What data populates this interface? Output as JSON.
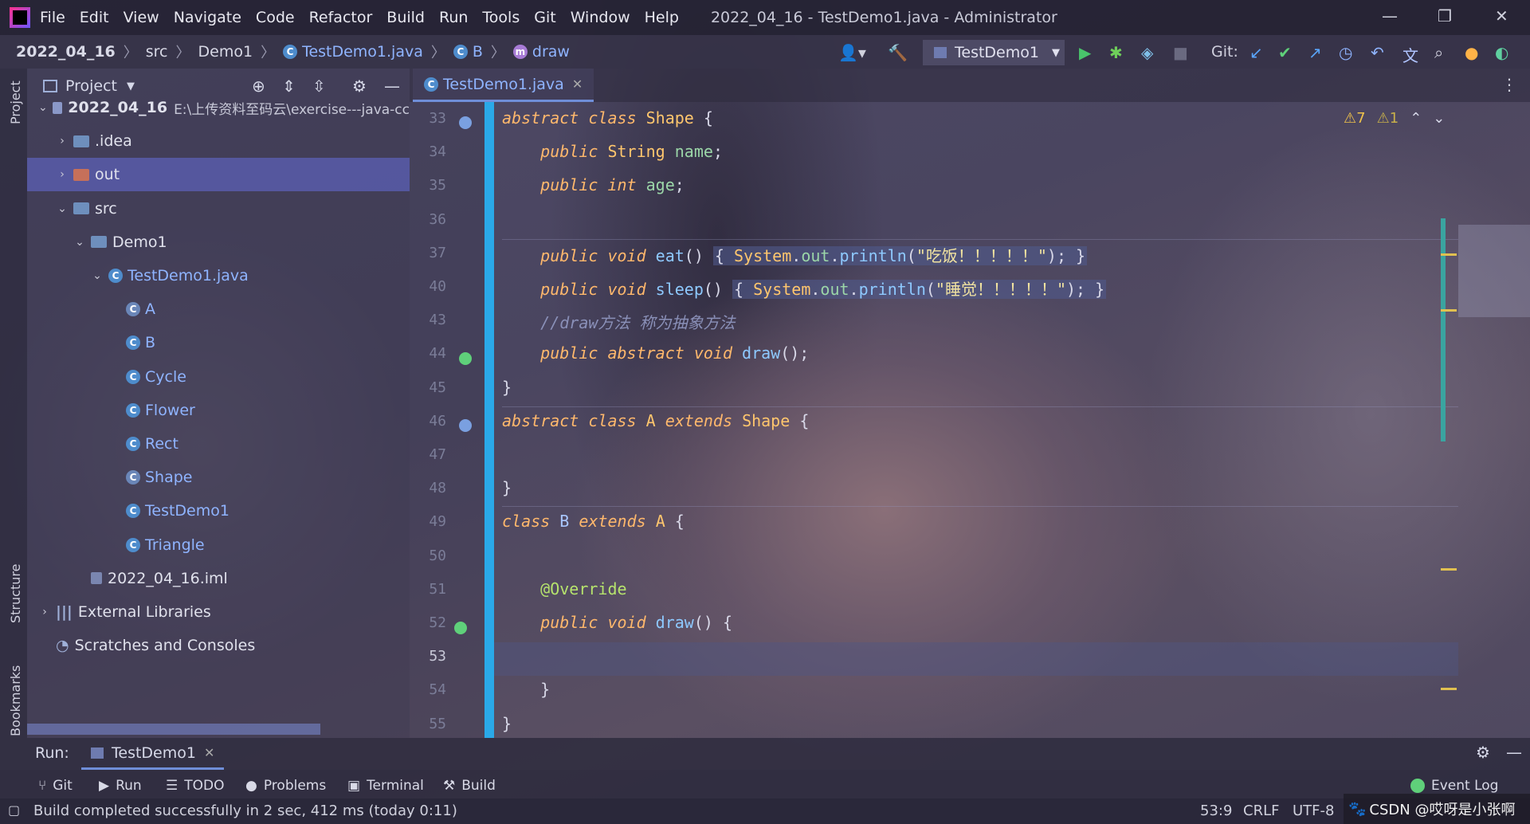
{
  "window": {
    "title": "2022_04_16 - TestDemo1.java - Administrator",
    "menu": [
      "File",
      "Edit",
      "View",
      "Navigate",
      "Code",
      "Refactor",
      "Build",
      "Run",
      "Tools",
      "Git",
      "Window",
      "Help"
    ]
  },
  "breadcrumb": [
    "2022_04_16",
    "src",
    "Demo1",
    "TestDemo1.java",
    "B",
    "draw"
  ],
  "toolbar": {
    "run_config": "TestDemo1",
    "git_label": "Git:"
  },
  "project_panel": {
    "title": "Project",
    "tree": [
      {
        "label": "2022_04_16",
        "suffix": "E:\\上传资料至码云\\exercise---java-cc",
        "indent": 0,
        "type": "module",
        "expanded": true
      },
      {
        "label": ".idea",
        "indent": 1,
        "type": "folder",
        "expanded": false
      },
      {
        "label": "out",
        "indent": 1,
        "type": "folder-orange",
        "expanded": false,
        "selected": true
      },
      {
        "label": "src",
        "indent": 1,
        "type": "folder",
        "expanded": true
      },
      {
        "label": "Demo1",
        "indent": 2,
        "type": "package",
        "expanded": true
      },
      {
        "label": "TestDemo1.java",
        "indent": 3,
        "type": "java",
        "expanded": true
      },
      {
        "label": "A",
        "indent": 4,
        "type": "class-abstract"
      },
      {
        "label": "B",
        "indent": 4,
        "type": "class"
      },
      {
        "label": "Cycle",
        "indent": 4,
        "type": "class"
      },
      {
        "label": "Flower",
        "indent": 4,
        "type": "class"
      },
      {
        "label": "Rect",
        "indent": 4,
        "type": "class"
      },
      {
        "label": "Shape",
        "indent": 4,
        "type": "class-abstract"
      },
      {
        "label": "TestDemo1",
        "indent": 4,
        "type": "class-main"
      },
      {
        "label": "Triangle",
        "indent": 4,
        "type": "class"
      },
      {
        "label": "2022_04_16.iml",
        "indent": 2,
        "type": "iml"
      },
      {
        "label": "External Libraries",
        "indent": 0,
        "type": "lib",
        "expanded": false
      },
      {
        "label": "Scratches and Consoles",
        "indent": 0,
        "type": "scratch"
      }
    ]
  },
  "side_labels": {
    "project": "Project",
    "structure": "Structure",
    "bookmarks": "Bookmarks"
  },
  "editor": {
    "tab": "TestDemo1.java",
    "inspections": {
      "warnings": "7",
      "weak_warnings": "1"
    },
    "lines": [
      {
        "n": "33",
        "html": "<span class='kw'>abstract class</span> <span class='ty'>Shape</span> {"
      },
      {
        "n": "34",
        "html": "    <span class='kw'>public</span> <span class='ty'>String</span> <span class='fld'>name</span>;"
      },
      {
        "n": "35",
        "html": "    <span class='kw'>public int</span> <span class='fld'>age</span>;"
      },
      {
        "n": "36",
        "html": ""
      },
      {
        "n": "37",
        "html": "    <span class='kw'>public void</span> <span class='fn'>eat</span>() <span class='hl'>{ <span class='ty'>System</span>.<span class='fld'>out</span>.<span class='fn'>println</span>(<span class='str'>\"吃饭！！！！！\"</span>); }</span>"
      },
      {
        "n": "40",
        "html": "    <span class='kw'>public void</span> <span class='fn'>sleep</span>() <span class='hl'>{ <span class='ty'>System</span>.<span class='fld'>out</span>.<span class='fn'>println</span>(<span class='str'>\"睡觉！！！！！\"</span>); }</span>"
      },
      {
        "n": "43",
        "html": "    <span class='cm'>//draw方法 称为抽象方法</span>"
      },
      {
        "n": "44",
        "html": "    <span class='kw'>public abstract void</span> <span class='fn'>draw</span>();"
      },
      {
        "n": "45",
        "html": "}"
      },
      {
        "n": "46",
        "html": "<span class='kw'>abstract class</span> <span class='ty'>A</span> <span class='kw'>extends</span> <span class='ty'>Shape</span> {"
      },
      {
        "n": "47",
        "html": ""
      },
      {
        "n": "48",
        "html": "}"
      },
      {
        "n": "49",
        "html": "<span class='kw'>class</span> <span class='cls'>B</span> <span class='kw'>extends</span> <span class='ty'>A</span> {"
      },
      {
        "n": "50",
        "html": ""
      },
      {
        "n": "51",
        "html": "    <span class='an'>@Override</span>"
      },
      {
        "n": "52",
        "html": "    <span class='kw'>public void</span> <span class='fn'>draw</span>() {"
      },
      {
        "n": "53",
        "html": ""
      },
      {
        "n": "54",
        "html": "    }"
      },
      {
        "n": "55",
        "html": "}"
      }
    ],
    "current_line": "53"
  },
  "run_panel": {
    "label": "Run:",
    "tab": "TestDemo1"
  },
  "tool_windows": [
    "Git",
    "Run",
    "TODO",
    "Problems",
    "Terminal",
    "Build"
  ],
  "event_log": "Event Log",
  "status": {
    "message": "Build completed successfully in 2 sec, 412 ms (today 0:11)",
    "position": "53:9",
    "line_sep": "CRLF",
    "encoding": "UTF-8",
    "watermark": "CSDN @哎呀是小张啊"
  },
  "colors": {
    "accent": "#8fb4ff",
    "selection": "#585caa",
    "fold_bar": "#2aa9e8"
  }
}
